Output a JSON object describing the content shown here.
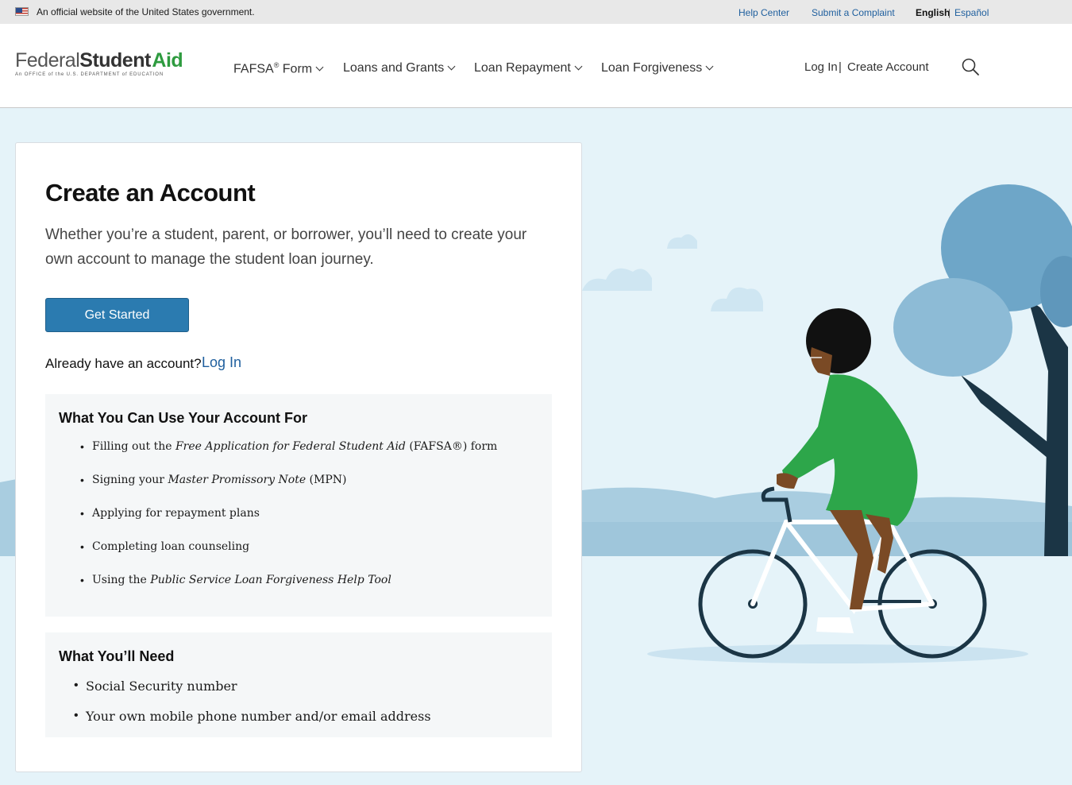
{
  "gov_banner": {
    "official_text": "An official website of the United States government.",
    "help_center": "Help Center",
    "submit_complaint": "Submit a Complaint",
    "lang_english": "English",
    "lang_separator": "|",
    "lang_espanol": "Español"
  },
  "header": {
    "logo": {
      "part1": "Federal",
      "part2": "Student",
      "part3": "Aid",
      "subtitle": "An OFFICE of the U.S. DEPARTMENT of EDUCATION"
    },
    "nav": [
      {
        "label": "FAFSA",
        "sup": "®",
        "rest": " Form"
      },
      {
        "label": "Loans and Grants"
      },
      {
        "label": "Loan Repayment"
      },
      {
        "label": "Loan Forgiveness"
      }
    ],
    "login": "Log In",
    "auth_separator": "|",
    "create_account": "Create Account",
    "search_icon": "search-icon"
  },
  "main": {
    "title": "Create an Account",
    "intro": "Whether you’re a student, parent, or borrower, you’ll need to create your own account to manage the student loan journey.",
    "get_started": "Get Started",
    "already_text": "Already have an account?",
    "login_link": "Log In",
    "use_box": {
      "title": "What You Can Use Your Account For",
      "items": [
        {
          "pre": "Filling out the ",
          "it": "Free Application for Federal Student Aid",
          "post": " (FAFSA®) form"
        },
        {
          "pre": "Signing your ",
          "it": "Master Promissory Note",
          "post": " (MPN)"
        },
        {
          "pre": "Applying for repayment plans",
          "it": "",
          "post": ""
        },
        {
          "pre": "Completing loan counseling",
          "it": "",
          "post": ""
        },
        {
          "pre": "Using the ",
          "it": "Public Service Loan Forgiveness Help Tool",
          "post": ""
        }
      ]
    },
    "need_box": {
      "title": "What You’ll Need",
      "items": [
        "Social Security number",
        "Your own mobile phone number and/or email address"
      ]
    }
  },
  "colors": {
    "link": "#1f5f9e",
    "button": "#2b7bb0",
    "brand_green": "#2e9b3f",
    "background": "#e5f3f9"
  }
}
